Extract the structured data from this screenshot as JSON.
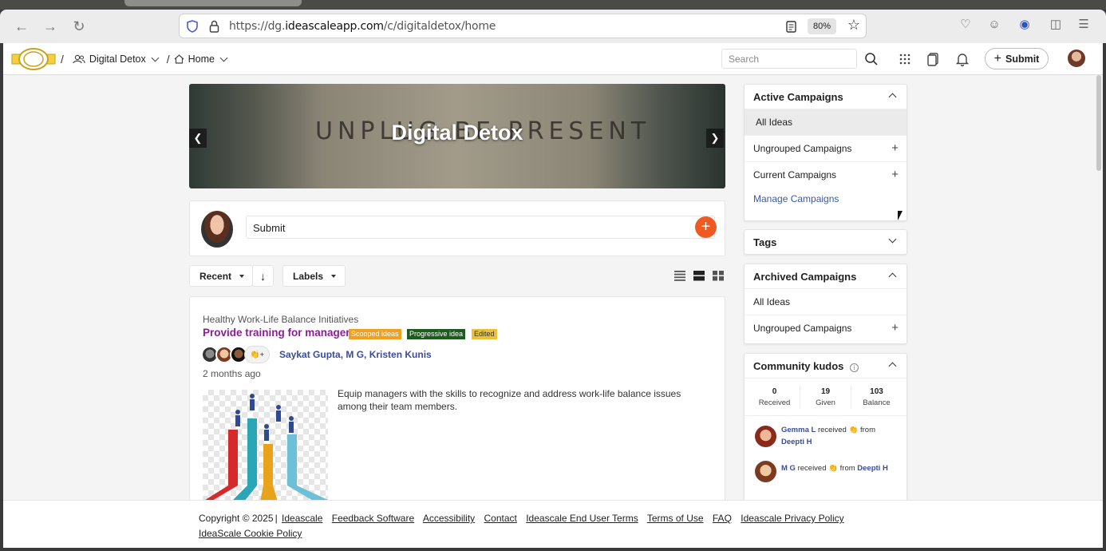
{
  "browser": {
    "url_prefix": "https://dg.",
    "url_domain": "ideascaleapp.com",
    "url_path": "/c/digitaldetox/home",
    "zoom": "80%"
  },
  "header": {
    "breadcrumb_community": "Digital Detox",
    "breadcrumb_page": "Home",
    "search_placeholder": "Search",
    "submit_label": "Submit"
  },
  "banner": {
    "title": "Digital Detox",
    "stone_text": "UNPLUG   BE PRESENT"
  },
  "submit_box": {
    "placeholder": "Submit"
  },
  "filters": {
    "sort_label": "Recent",
    "labels_label": "Labels"
  },
  "idea": {
    "campaign": "Healthy Work-Life Balance Initiatives",
    "title": "Provide training for managers",
    "badges": [
      {
        "text": "Scooped ideas",
        "bg": "#f0a020",
        "fg": "#fff"
      },
      {
        "text": "Progressive idea",
        "bg": "#1f5a1f",
        "fg": "#fff"
      },
      {
        "text": "Edited",
        "bg": "#e8c33a",
        "fg": "#333"
      }
    ],
    "authors": "Saykat Gupta, M G, Kristen Kunis",
    "time": "2 months ago",
    "description": "Equip managers with the skills to recognize and address work-life balance issues among their team members."
  },
  "sidebar": {
    "active": {
      "title": "Active Campaigns",
      "items": [
        "All Ideas",
        "Ungrouped Campaigns",
        "Current Campaigns"
      ],
      "manage": "Manage Campaigns"
    },
    "tags": {
      "title": "Tags"
    },
    "archived": {
      "title": "Archived Campaigns",
      "items": [
        "All Ideas",
        "Ungrouped Campaigns"
      ]
    },
    "kudos": {
      "title": "Community kudos",
      "received": "0",
      "received_label": "Received",
      "given": "19",
      "given_label": "Given",
      "balance": "103",
      "balance_label": "Balance",
      "feed": [
        {
          "user": "Gemma L",
          "verb": "received",
          "from": "from",
          "giver": "Deepti H"
        },
        {
          "user": "M G",
          "verb": "received",
          "from": "from",
          "giver": "Deepti H"
        }
      ]
    }
  },
  "footer": {
    "copyright": "Copyright © 2025",
    "links": [
      "Ideascale",
      "Feedback Software",
      "Accessibility",
      "Contact",
      "Ideascale End User Terms",
      "Terms of Use",
      "FAQ",
      "Ideascale Privacy Policy"
    ],
    "cookie": "IdeaScale Cookie Policy"
  },
  "icons": [
    "back-icon",
    "forward-icon",
    "reload-icon",
    "shield-icon",
    "lock-icon",
    "reader-icon",
    "star-icon",
    "pocket-icon",
    "account-icon",
    "extension-icon",
    "menu-icon",
    "community-icon",
    "home-icon",
    "search-icon",
    "apps-grid-icon",
    "docs-icon",
    "bell-icon",
    "plus-icon",
    "info-icon",
    "clap-icon"
  ]
}
